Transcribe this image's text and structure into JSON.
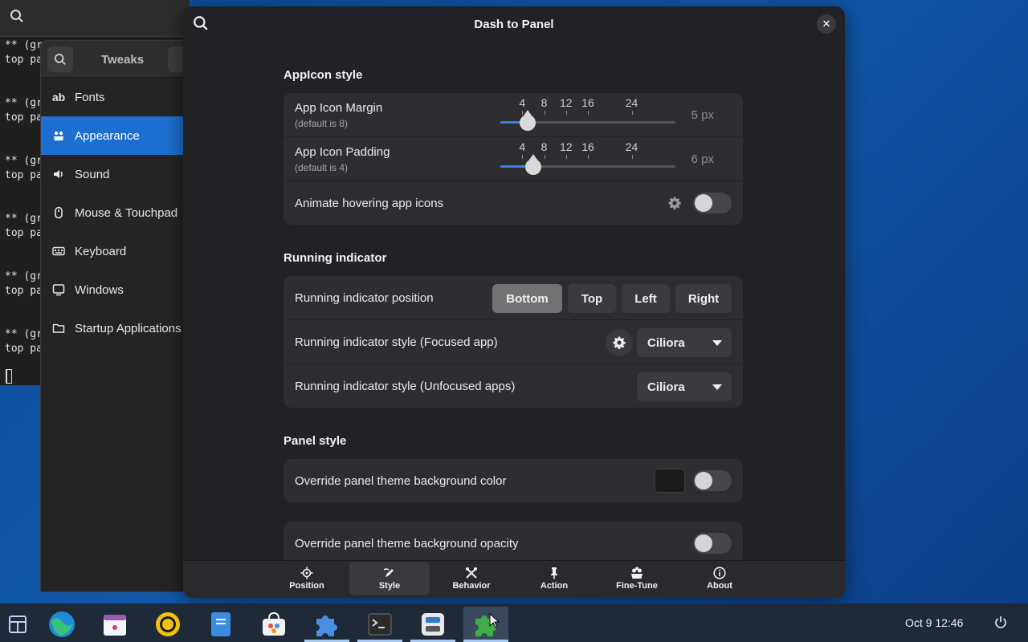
{
  "terminal": {
    "blocks": [
      [
        "** (gr",
        "top pa"
      ],
      [
        "** (gr",
        "top pa"
      ],
      [
        "** (gr",
        "top pa"
      ],
      [
        "** (gr",
        "top pa"
      ],
      [
        "** (gr",
        "top pa"
      ],
      [
        "** (gr",
        "top pa"
      ]
    ]
  },
  "tweaks": {
    "title": "Tweaks",
    "items": [
      {
        "label": "Fonts",
        "icon": "fonts-icon",
        "active": false
      },
      {
        "label": "Appearance",
        "icon": "appearance-icon",
        "active": true
      },
      {
        "label": "Sound",
        "icon": "sound-icon",
        "active": false
      },
      {
        "label": "Mouse & Touchpad",
        "icon": "mouse-icon",
        "active": false
      },
      {
        "label": "Keyboard",
        "icon": "keyboard-icon",
        "active": false
      },
      {
        "label": "Windows",
        "icon": "windows-icon",
        "active": false
      },
      {
        "label": "Startup Applications",
        "icon": "folder-icon",
        "active": false
      }
    ]
  },
  "dialog": {
    "title": "Dash to Panel",
    "sections": {
      "appicon": {
        "title": "AppIcon style",
        "margin": {
          "label": "App Icon Margin",
          "sub": "(default is 8)",
          "value_text": "5 px",
          "value": 5
        },
        "padding": {
          "label": "App Icon Padding",
          "sub": "(default is 4)",
          "value_text": "6 px",
          "value": 6
        },
        "slider_ticks": [
          "4",
          "8",
          "12",
          "16",
          "24"
        ],
        "slider_range": [
          0,
          32
        ],
        "animate": {
          "label": "Animate hovering app icons",
          "on": false
        }
      },
      "running": {
        "title": "Running indicator",
        "position": {
          "label": "Running indicator position",
          "options": [
            "Bottom",
            "Top",
            "Left",
            "Right"
          ],
          "selected": "Bottom"
        },
        "focused": {
          "label": "Running indicator style (Focused app)",
          "value": "Ciliora"
        },
        "unfocused": {
          "label": "Running indicator style (Unfocused apps)",
          "value": "Ciliora"
        }
      },
      "panel": {
        "title": "Panel style",
        "bgcolor": {
          "label": "Override panel theme background color",
          "on": false,
          "swatch": "#1a1a1a"
        },
        "opacity": {
          "label": "Override panel theme background opacity",
          "on": false
        }
      }
    },
    "nav": [
      {
        "label": "Position",
        "icon": "position-icon",
        "active": false
      },
      {
        "label": "Style",
        "icon": "style-icon",
        "active": true
      },
      {
        "label": "Behavior",
        "icon": "behavior-icon",
        "active": false
      },
      {
        "label": "Action",
        "icon": "action-icon",
        "active": false
      },
      {
        "label": "Fine-Tune",
        "icon": "fine-tune-icon",
        "active": false
      },
      {
        "label": "About",
        "icon": "about-icon",
        "active": false
      }
    ]
  },
  "taskbar": {
    "clock": "Oct 9  12:46",
    "apps": [
      "browser",
      "calendar",
      "rhythmbox",
      "files",
      "software",
      "extensions",
      "terminal",
      "tweaks",
      "extension-prefs"
    ]
  },
  "colors": {
    "accent": "#1c6fd0",
    "slider": "#3584e4",
    "desktop": "#0f4c96"
  }
}
